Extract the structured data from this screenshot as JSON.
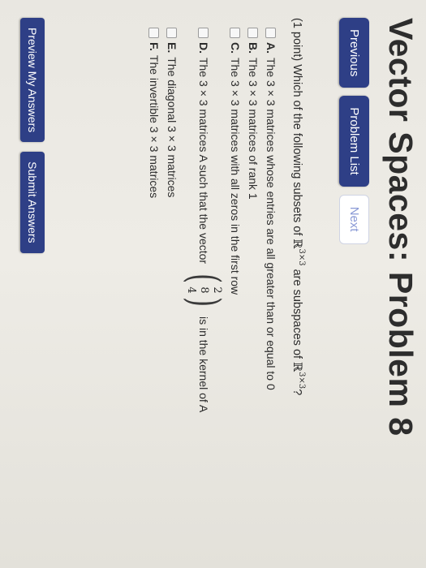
{
  "page": {
    "title": "Vector Spaces: Problem 8"
  },
  "nav": {
    "previous": "Previous",
    "problem_list": "Problem List",
    "next": "Next"
  },
  "question": {
    "prefix": "(1 point) Which of the following subsets of ",
    "set_symbol": "ℝ",
    "set_exponent": "3×3",
    "middle": " are subspaces of ",
    "set_symbol_2": "ℝ",
    "set_exponent_2": "3×3",
    "suffix": "?"
  },
  "options": [
    {
      "letter": "A.",
      "text": "The 3 × 3 matrices whose entries are all greater than or equal to 0"
    },
    {
      "letter": "B.",
      "text": "The 3 × 3 matrices of rank 1"
    },
    {
      "letter": "C.",
      "text": "The 3 × 3 matrices with all zeros in the first row"
    },
    {
      "letter": "D.",
      "text_before": "The 3 × 3 matrices A such that the vector",
      "vector": [
        "2",
        "8",
        "4"
      ],
      "text_after": "is in the kernel of A"
    },
    {
      "letter": "E.",
      "text": "The diagonal 3 × 3 matrices"
    },
    {
      "letter": "F.",
      "text": "The invertible 3 × 3 matrices"
    }
  ],
  "actions": {
    "preview": "Preview My Answers",
    "submit": "Submit Answers"
  },
  "colors": {
    "primary_button": "#2e3f86",
    "disabled_text": "#8a9ad6"
  }
}
